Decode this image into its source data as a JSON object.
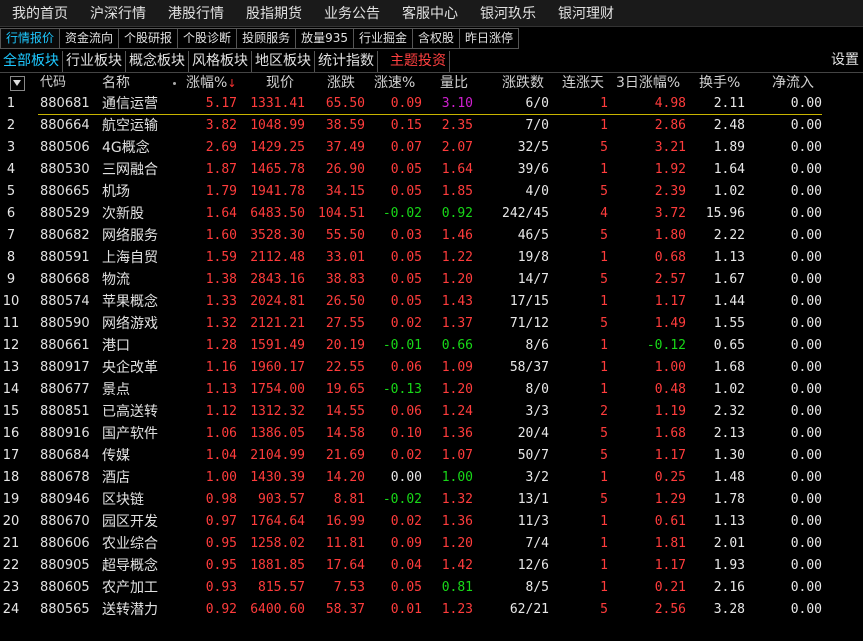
{
  "menu": [
    "我的首页",
    "沪深行情",
    "港股行情",
    "股指期货",
    "业务公告",
    "客服中心",
    "银河玖乐",
    "银河理财"
  ],
  "tabs": [
    "行情报价",
    "资金流向",
    "个股研报",
    "个股诊断",
    "投顾服务",
    "放量935",
    "行业掘金",
    "含权股",
    "昨日涨停"
  ],
  "boards": [
    "全部板块",
    "行业板块",
    "概念板块",
    "风格板块",
    "地区板块",
    "统计指数",
    "主题投资"
  ],
  "settings_label": "设置",
  "headers": {
    "code": "代码",
    "name": "名称",
    "zf": "涨幅%",
    "sort": "↓",
    "xj": "现价",
    "zd": "涨跌",
    "zs": "涨速%",
    "lb": "量比",
    "zds": "涨跌数",
    "lzt": "连涨天",
    "r3": "3日涨幅%",
    "hs": "换手%",
    "jlr": "净流入"
  },
  "colors": {
    "up": "#ff3c3c",
    "down": "#18d818",
    "flat": "#e8e8e8",
    "accent": "#1ec8ff",
    "highlight": "#d020d0"
  },
  "rows": [
    {
      "i": "1",
      "code": "880681",
      "name": "通信运营",
      "zf": "5.17",
      "xj": "1331.41",
      "zd": "65.50",
      "zs": "0.09",
      "lb": "3.10",
      "zds": "6/0",
      "lzt": "1",
      "r3": "4.98",
      "hs": "2.11",
      "jlr": "0.00"
    },
    {
      "i": "2",
      "code": "880664",
      "name": "航空运输",
      "zf": "3.82",
      "xj": "1048.99",
      "zd": "38.59",
      "zs": "0.15",
      "lb": "2.35",
      "zds": "7/0",
      "lzt": "1",
      "r3": "2.86",
      "hs": "2.48",
      "jlr": "0.00"
    },
    {
      "i": "3",
      "code": "880506",
      "name": "4G概念",
      "zf": "2.69",
      "xj": "1429.25",
      "zd": "37.49",
      "zs": "0.07",
      "lb": "2.07",
      "zds": "32/5",
      "lzt": "5",
      "r3": "3.21",
      "hs": "1.89",
      "jlr": "0.00"
    },
    {
      "i": "4",
      "code": "880530",
      "name": "三网融合",
      "zf": "1.87",
      "xj": "1465.78",
      "zd": "26.90",
      "zs": "0.05",
      "lb": "1.64",
      "zds": "39/6",
      "lzt": "1",
      "r3": "1.92",
      "hs": "1.64",
      "jlr": "0.00"
    },
    {
      "i": "5",
      "code": "880665",
      "name": "机场",
      "zf": "1.79",
      "xj": "1941.78",
      "zd": "34.15",
      "zs": "0.05",
      "lb": "1.85",
      "zds": "4/0",
      "lzt": "5",
      "r3": "2.39",
      "hs": "1.02",
      "jlr": "0.00"
    },
    {
      "i": "6",
      "code": "880529",
      "name": "次新股",
      "zf": "1.64",
      "xj": "6483.50",
      "zd": "104.51",
      "zs": "-0.02",
      "lb": "0.92",
      "zds": "242/45",
      "lzt": "4",
      "r3": "3.72",
      "hs": "15.96",
      "jlr": "0.00"
    },
    {
      "i": "7",
      "code": "880682",
      "name": "网络服务",
      "zf": "1.60",
      "xj": "3528.30",
      "zd": "55.50",
      "zs": "0.03",
      "lb": "1.46",
      "zds": "46/5",
      "lzt": "5",
      "r3": "1.80",
      "hs": "2.22",
      "jlr": "0.00"
    },
    {
      "i": "8",
      "code": "880591",
      "name": "上海自贸",
      "zf": "1.59",
      "xj": "2112.48",
      "zd": "33.01",
      "zs": "0.05",
      "lb": "1.22",
      "zds": "19/8",
      "lzt": "1",
      "r3": "0.68",
      "hs": "1.13",
      "jlr": "0.00"
    },
    {
      "i": "9",
      "code": "880668",
      "name": "物流",
      "zf": "1.38",
      "xj": "2843.16",
      "zd": "38.83",
      "zs": "0.05",
      "lb": "1.20",
      "zds": "14/7",
      "lzt": "5",
      "r3": "2.57",
      "hs": "1.67",
      "jlr": "0.00"
    },
    {
      "i": "10",
      "code": "880574",
      "name": "苹果概念",
      "zf": "1.33",
      "xj": "2024.81",
      "zd": "26.50",
      "zs": "0.05",
      "lb": "1.43",
      "zds": "17/15",
      "lzt": "1",
      "r3": "1.17",
      "hs": "1.44",
      "jlr": "0.00"
    },
    {
      "i": "11",
      "code": "880590",
      "name": "网络游戏",
      "zf": "1.32",
      "xj": "2121.21",
      "zd": "27.55",
      "zs": "0.02",
      "lb": "1.37",
      "zds": "71/12",
      "lzt": "5",
      "r3": "1.49",
      "hs": "1.55",
      "jlr": "0.00"
    },
    {
      "i": "12",
      "code": "880661",
      "name": "港口",
      "zf": "1.28",
      "xj": "1591.49",
      "zd": "20.19",
      "zs": "-0.01",
      "lb": "0.66",
      "zds": "8/6",
      "lzt": "1",
      "r3": "-0.12",
      "hs": "0.65",
      "jlr": "0.00"
    },
    {
      "i": "13",
      "code": "880917",
      "name": "央企改革",
      "zf": "1.16",
      "xj": "1960.17",
      "zd": "22.55",
      "zs": "0.06",
      "lb": "1.09",
      "zds": "58/37",
      "lzt": "1",
      "r3": "1.00",
      "hs": "1.68",
      "jlr": "0.00"
    },
    {
      "i": "14",
      "code": "880677",
      "name": "景点",
      "zf": "1.13",
      "xj": "1754.00",
      "zd": "19.65",
      "zs": "-0.13",
      "lb": "1.20",
      "zds": "8/0",
      "lzt": "1",
      "r3": "0.48",
      "hs": "1.02",
      "jlr": "0.00"
    },
    {
      "i": "15",
      "code": "880851",
      "name": "已高送转",
      "zf": "1.12",
      "xj": "1312.32",
      "zd": "14.55",
      "zs": "0.06",
      "lb": "1.24",
      "zds": "3/3",
      "lzt": "2",
      "r3": "1.19",
      "hs": "2.32",
      "jlr": "0.00"
    },
    {
      "i": "16",
      "code": "880916",
      "name": "国产软件",
      "zf": "1.06",
      "xj": "1386.05",
      "zd": "14.58",
      "zs": "0.10",
      "lb": "1.36",
      "zds": "20/4",
      "lzt": "5",
      "r3": "1.68",
      "hs": "2.13",
      "jlr": "0.00"
    },
    {
      "i": "17",
      "code": "880684",
      "name": "传媒",
      "zf": "1.04",
      "xj": "2104.99",
      "zd": "21.69",
      "zs": "0.02",
      "lb": "1.07",
      "zds": "50/7",
      "lzt": "5",
      "r3": "1.17",
      "hs": "1.30",
      "jlr": "0.00"
    },
    {
      "i": "18",
      "code": "880678",
      "name": "酒店",
      "zf": "1.00",
      "xj": "1430.39",
      "zd": "14.20",
      "zs": "0.00",
      "lb": "1.00",
      "zds": "3/2",
      "lzt": "1",
      "r3": "0.25",
      "hs": "1.48",
      "jlr": "0.00"
    },
    {
      "i": "19",
      "code": "880946",
      "name": "区块链",
      "zf": "0.98",
      "xj": "903.57",
      "zd": "8.81",
      "zs": "-0.02",
      "lb": "1.32",
      "zds": "13/1",
      "lzt": "5",
      "r3": "1.29",
      "hs": "1.78",
      "jlr": "0.00"
    },
    {
      "i": "20",
      "code": "880670",
      "name": "园区开发",
      "zf": "0.97",
      "xj": "1764.64",
      "zd": "16.99",
      "zs": "0.02",
      "lb": "1.36",
      "zds": "11/3",
      "lzt": "1",
      "r3": "0.61",
      "hs": "1.13",
      "jlr": "0.00"
    },
    {
      "i": "21",
      "code": "880606",
      "name": "农业综合",
      "zf": "0.95",
      "xj": "1258.02",
      "zd": "11.81",
      "zs": "0.09",
      "lb": "1.20",
      "zds": "7/4",
      "lzt": "1",
      "r3": "1.81",
      "hs": "2.01",
      "jlr": "0.00"
    },
    {
      "i": "22",
      "code": "880905",
      "name": "超导概念",
      "zf": "0.95",
      "xj": "1881.85",
      "zd": "17.64",
      "zs": "0.04",
      "lb": "1.42",
      "zds": "12/6",
      "lzt": "1",
      "r3": "1.17",
      "hs": "1.93",
      "jlr": "0.00"
    },
    {
      "i": "23",
      "code": "880605",
      "name": "农产加工",
      "zf": "0.93",
      "xj": "815.57",
      "zd": "7.53",
      "zs": "0.05",
      "lb": "0.81",
      "zds": "8/5",
      "lzt": "1",
      "r3": "0.21",
      "hs": "2.16",
      "jlr": "0.00"
    },
    {
      "i": "24",
      "code": "880565",
      "name": "送转潜力",
      "zf": "0.92",
      "xj": "6400.60",
      "zd": "58.37",
      "zs": "0.01",
      "lb": "1.23",
      "zds": "62/21",
      "lzt": "5",
      "r3": "2.56",
      "hs": "3.28",
      "jlr": "0.00"
    }
  ]
}
